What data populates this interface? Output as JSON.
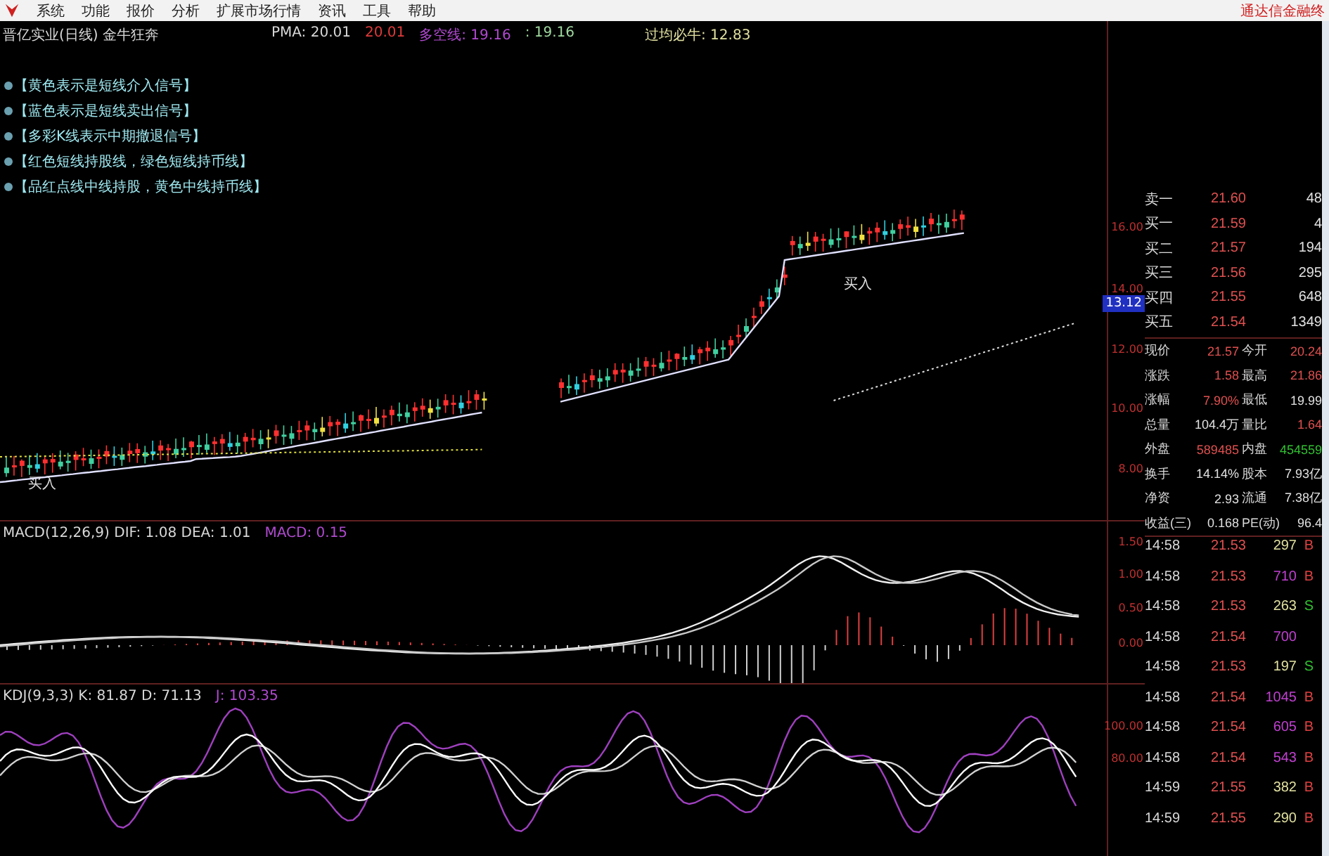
{
  "menu": {
    "items": [
      "系统",
      "功能",
      "报价",
      "分析",
      "扩展市场行情",
      "资讯",
      "工具",
      "帮助"
    ],
    "brand": "通达信金融终"
  },
  "chart_header": [
    {
      "text": "晋亿实业(日线) 金牛狂奔",
      "color": "#d8d8d8"
    },
    {
      "text": "PMA: 20.01",
      "color": "#d8d8d8"
    },
    {
      "text": "20.01",
      "color": "#e03a3a"
    },
    {
      "text": "多空线: 19.16",
      "color": "#b04ad0"
    },
    {
      "text": ": 19.16",
      "color": "#9fd89f"
    },
    {
      "text": "过均必牛: 12.83",
      "color": "#e0e0a0"
    }
  ],
  "legend": [
    "【黄色表示是短线介入信号】",
    "【蓝色表示是短线卖出信号】",
    "【多彩K线表示中期撤退信号】",
    "【红色短线持股线，绿色短线持币线】",
    "【品红点线中线持股，黄色中线持币线】"
  ],
  "price_axis": [
    "16.00",
    "14.00",
    "12.00",
    "10.00",
    "8.00"
  ],
  "price_marker": "13.12",
  "chart_annotations": [
    "买入",
    "买入"
  ],
  "macd": {
    "label": "MACD(12,26,9) DIF: 1.08 DEA: 1.01",
    "value": "MACD: 0.15",
    "axis": [
      "1.50",
      "1.00",
      "0.50",
      "0.00"
    ]
  },
  "kdj": {
    "label": "KDJ(9,3,3) K: 81.87 D: 71.13",
    "value": "J: 103.35",
    "axis": [
      "100.00",
      "80.00"
    ]
  },
  "order_book": [
    {
      "label": "卖一",
      "price": "21.60",
      "volume": "48"
    },
    {
      "label": "买一",
      "price": "21.59",
      "volume": "4"
    },
    {
      "label": "买二",
      "price": "21.57",
      "volume": "194"
    },
    {
      "label": "买三",
      "price": "21.56",
      "volume": "295"
    },
    {
      "label": "买四",
      "price": "21.55",
      "volume": "648"
    },
    {
      "label": "买五",
      "price": "21.54",
      "volume": "1349"
    }
  ],
  "quote_stats": [
    [
      {
        "label": "现价",
        "value": "21.57",
        "kind": "up"
      },
      {
        "label": "今开",
        "value": "20.24",
        "kind": "up"
      }
    ],
    [
      {
        "label": "涨跌",
        "value": "1.58",
        "kind": "up"
      },
      {
        "label": "最高",
        "value": "21.86",
        "kind": "up"
      }
    ],
    [
      {
        "label": "涨幅",
        "value": "7.90%",
        "kind": "up"
      },
      {
        "label": "最低",
        "value": "19.99",
        "kind": "flat"
      }
    ],
    [
      {
        "label": "总量",
        "value": "104.4万",
        "kind": "flat"
      },
      {
        "label": "量比",
        "value": "1.64",
        "kind": "up"
      }
    ],
    [
      {
        "label": "外盘",
        "value": "589485",
        "kind": "up"
      },
      {
        "label": "内盘",
        "value": "454559",
        "kind": "down"
      }
    ],
    [
      {
        "label": "换手",
        "value": "14.14%",
        "kind": "flat"
      },
      {
        "label": "股本",
        "value": "7.93亿",
        "kind": "flat"
      }
    ],
    [
      {
        "label": "净资",
        "value": "2.93",
        "kind": "flat"
      },
      {
        "label": "流通",
        "value": "7.38亿",
        "kind": "flat"
      }
    ],
    [
      {
        "label": "收益(三)",
        "value": "0.168",
        "kind": "flat"
      },
      {
        "label": "PE(动)",
        "value": "96.4",
        "kind": "flat"
      }
    ]
  ],
  "ticks": [
    {
      "time": "14:58",
      "price": "21.53",
      "volume": "297",
      "side": "B",
      "kind": "buy",
      "color": "#e0e0a0"
    },
    {
      "time": "14:58",
      "price": "21.53",
      "volume": "710",
      "side": "B",
      "kind": "buy",
      "color": "#c040d0"
    },
    {
      "time": "14:58",
      "price": "21.53",
      "volume": "263",
      "side": "S",
      "kind": "sell",
      "color": "#e0e0a0"
    },
    {
      "time": "14:58",
      "price": "21.54",
      "volume": "700",
      "kind": "none",
      "color": "#c040d0"
    },
    {
      "time": "14:58",
      "price": "21.53",
      "volume": "197",
      "side": "S",
      "kind": "sell",
      "color": "#e0e0a0"
    },
    {
      "time": "14:58",
      "price": "21.54",
      "volume": "1045",
      "side": "B",
      "kind": "buy",
      "color": "#c040d0"
    },
    {
      "time": "14:58",
      "price": "21.54",
      "volume": "605",
      "side": "B",
      "kind": "buy",
      "color": "#c040d0"
    },
    {
      "time": "14:58",
      "price": "21.54",
      "volume": "543",
      "side": "B",
      "kind": "buy",
      "color": "#c040d0"
    },
    {
      "time": "14:59",
      "price": "21.55",
      "volume": "382",
      "side": "B",
      "kind": "buy",
      "color": "#e0e0a0"
    },
    {
      "time": "14:59",
      "price": "21.55",
      "volume": "290",
      "side": "B",
      "kind": "buy",
      "color": "#e0e0a0"
    }
  ]
}
